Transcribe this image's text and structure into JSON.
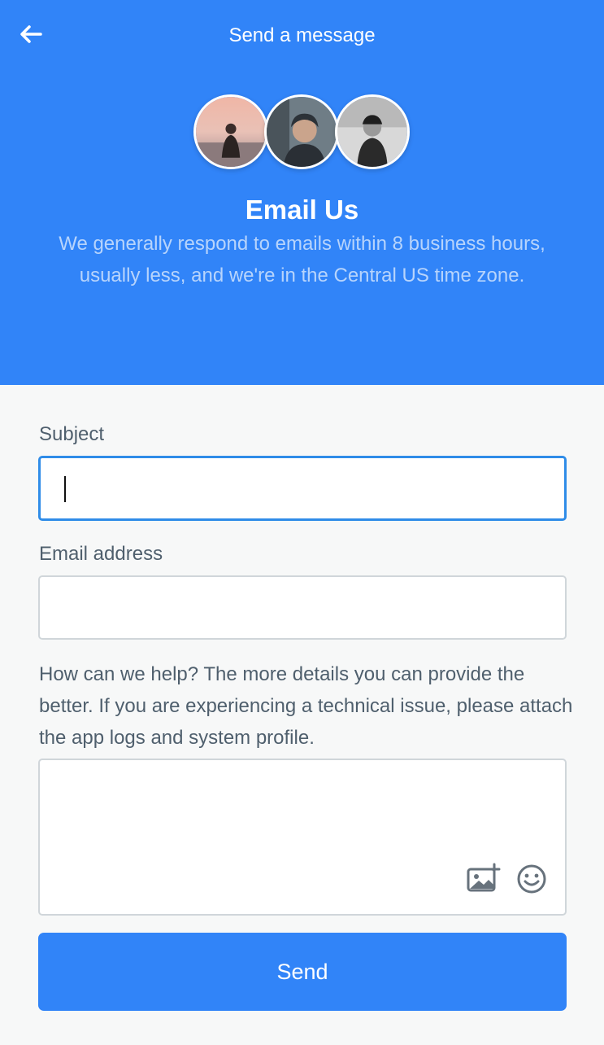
{
  "header": {
    "title": "Send a message",
    "back_icon": "arrow-left-icon",
    "heading": "Email Us",
    "subtext": "We generally respond to emails within 8 business hours, usually less, and we're in the Central US time zone.",
    "bg_color": "#3184f8"
  },
  "form": {
    "subject_label": "Subject",
    "subject_value": "",
    "email_label": "Email address",
    "email_value": "",
    "message_label": "How can we help? The more details you can provide the better. If you are experiencing a technical issue, please attach the app logs and system profile.",
    "message_value": "",
    "attach_icon": "add-image-icon",
    "emoji_icon": "smiley-icon",
    "send_label": "Send",
    "accent": "#2f8ce8"
  }
}
